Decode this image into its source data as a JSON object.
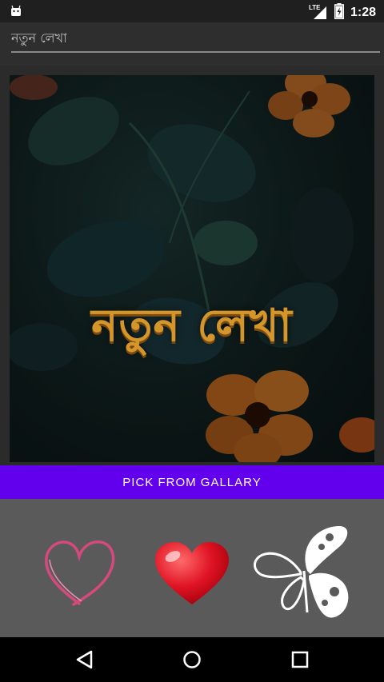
{
  "status_bar": {
    "time": "1:28",
    "network": "LTE",
    "icons": [
      "android-icon",
      "signal-icon",
      "battery-icon"
    ]
  },
  "editor": {
    "text_value": "নতুন লেখা"
  },
  "preview": {
    "overlay_text": "নতুন লেখা",
    "overlay_color": "#d4962b"
  },
  "actions": {
    "pick_label": "PICK FROM GALLARY",
    "accent_color": "#6200ee"
  },
  "stickers": [
    {
      "name": "outline-heart-sticker"
    },
    {
      "name": "red-heart-sticker"
    },
    {
      "name": "butterfly-sticker"
    }
  ],
  "nav": {
    "buttons": [
      "back-icon",
      "home-icon",
      "recents-icon"
    ]
  }
}
